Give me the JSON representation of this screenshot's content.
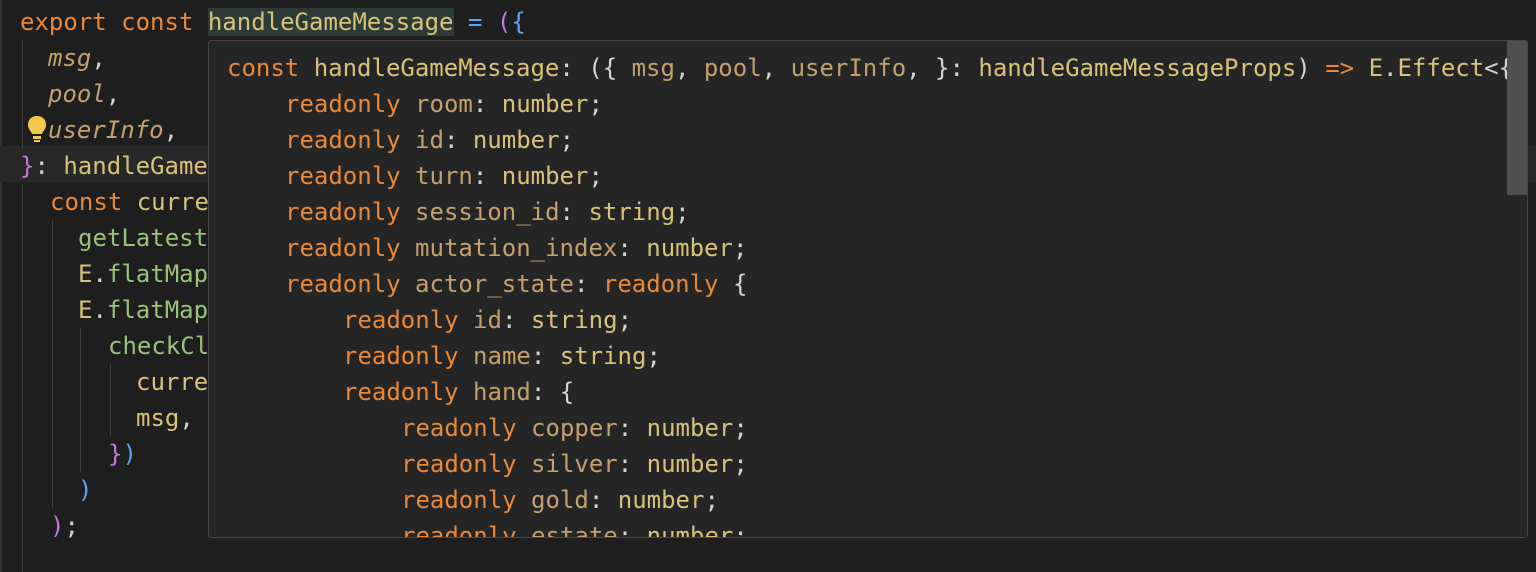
{
  "editor": {
    "lines": [
      {
        "parts": [
          [
            "kw",
            "export"
          ],
          [
            "punc",
            " "
          ],
          [
            "kw",
            "const"
          ],
          [
            "punc",
            " "
          ],
          [
            "fn hl",
            "handleGameMessage"
          ],
          [
            "punc",
            " "
          ],
          [
            "blue",
            "="
          ],
          [
            "punc",
            " "
          ],
          [
            "pink",
            "("
          ],
          [
            "blue",
            "{"
          ]
        ]
      },
      {
        "parts": [
          [
            "param",
            "msg"
          ],
          [
            "punc",
            ","
          ]
        ]
      },
      {
        "parts": [
          [
            "param",
            "pool"
          ],
          [
            "punc",
            ","
          ]
        ]
      },
      {
        "parts": [
          [
            "param",
            "userInfo"
          ],
          [
            "punc",
            ","
          ]
        ]
      },
      {
        "parts": [
          [
            "pink",
            "}"
          ],
          [
            "punc",
            ": "
          ],
          [
            "fn",
            "handleGame"
          ]
        ]
      },
      {
        "parts": [
          [
            "kw",
            "const"
          ],
          [
            "punc",
            " "
          ],
          [
            "fn",
            "curre"
          ]
        ]
      },
      {
        "parts": [
          [
            "green",
            "getLatest"
          ]
        ]
      },
      {
        "parts": [
          [
            "fn",
            "E"
          ],
          [
            "punc",
            "."
          ],
          [
            "green",
            "flatMap"
          ]
        ]
      },
      {
        "parts": [
          [
            "fn",
            "E"
          ],
          [
            "punc",
            "."
          ],
          [
            "green",
            "flatMap"
          ]
        ]
      },
      {
        "parts": [
          [
            "green",
            "checkCl"
          ]
        ]
      },
      {
        "parts": [
          [
            "fn",
            "curre"
          ]
        ]
      },
      {
        "parts": [
          [
            "fn",
            "msg"
          ],
          [
            "punc",
            ","
          ]
        ]
      },
      {
        "parts": [
          [
            "pink",
            "}"
          ],
          [
            "blue",
            ")"
          ]
        ]
      },
      {
        "parts": [
          [
            "blue",
            ")"
          ]
        ]
      },
      {
        "parts": [
          [
            "pink",
            ")"
          ],
          [
            "punc",
            ";"
          ]
        ]
      }
    ]
  },
  "hover": {
    "lines": [
      {
        "parts": [
          [
            "kw",
            "const"
          ],
          [
            "punc",
            " "
          ],
          [
            "fn",
            "handleGameMessage"
          ],
          [
            "punc",
            ": ({ "
          ],
          [
            "hprop",
            "msg"
          ],
          [
            "punc",
            ", "
          ],
          [
            "hprop",
            "pool"
          ],
          [
            "punc",
            ", "
          ],
          [
            "hprop",
            "userInfo"
          ],
          [
            "punc",
            ", }: "
          ],
          [
            "fn",
            "handleGameMessageProps"
          ],
          [
            "punc",
            ") "
          ],
          [
            "kw",
            "=>"
          ],
          [
            "punc",
            " "
          ],
          [
            "fn",
            "E"
          ],
          [
            "punc",
            "."
          ],
          [
            "fn",
            "Effect"
          ],
          [
            "punc",
            "<{"
          ]
        ]
      },
      {
        "parts": [
          [
            "kw",
            "readonly"
          ],
          [
            "punc",
            " "
          ],
          [
            "hprop",
            "room"
          ],
          [
            "punc",
            ": "
          ],
          [
            "htype",
            "number"
          ],
          [
            "punc",
            ";"
          ]
        ]
      },
      {
        "parts": [
          [
            "kw",
            "readonly"
          ],
          [
            "punc",
            " "
          ],
          [
            "hprop",
            "id"
          ],
          [
            "punc",
            ": "
          ],
          [
            "htype",
            "number"
          ],
          [
            "punc",
            ";"
          ]
        ]
      },
      {
        "parts": [
          [
            "kw",
            "readonly"
          ],
          [
            "punc",
            " "
          ],
          [
            "hprop",
            "turn"
          ],
          [
            "punc",
            ": "
          ],
          [
            "htype",
            "number"
          ],
          [
            "punc",
            ";"
          ]
        ]
      },
      {
        "parts": [
          [
            "kw",
            "readonly"
          ],
          [
            "punc",
            " "
          ],
          [
            "hprop",
            "session_id"
          ],
          [
            "punc",
            ": "
          ],
          [
            "htype",
            "string"
          ],
          [
            "punc",
            ";"
          ]
        ]
      },
      {
        "parts": [
          [
            "kw",
            "readonly"
          ],
          [
            "punc",
            " "
          ],
          [
            "hprop",
            "mutation_index"
          ],
          [
            "punc",
            ": "
          ],
          [
            "htype",
            "number"
          ],
          [
            "punc",
            ";"
          ]
        ]
      },
      {
        "parts": [
          [
            "kw",
            "readonly"
          ],
          [
            "punc",
            " "
          ],
          [
            "hprop",
            "actor_state"
          ],
          [
            "punc",
            ": "
          ],
          [
            "kw",
            "readonly"
          ],
          [
            "punc",
            " {"
          ]
        ]
      },
      {
        "parts": [
          [
            "kw",
            "readonly"
          ],
          [
            "punc",
            " "
          ],
          [
            "hprop",
            "id"
          ],
          [
            "punc",
            ": "
          ],
          [
            "htype",
            "string"
          ],
          [
            "punc",
            ";"
          ]
        ]
      },
      {
        "parts": [
          [
            "kw",
            "readonly"
          ],
          [
            "punc",
            " "
          ],
          [
            "hprop",
            "name"
          ],
          [
            "punc",
            ": "
          ],
          [
            "htype",
            "string"
          ],
          [
            "punc",
            ";"
          ]
        ]
      },
      {
        "parts": [
          [
            "kw",
            "readonly"
          ],
          [
            "punc",
            " "
          ],
          [
            "hprop",
            "hand"
          ],
          [
            "punc",
            ": {"
          ]
        ]
      },
      {
        "parts": [
          [
            "kw",
            "readonly"
          ],
          [
            "punc",
            " "
          ],
          [
            "hprop",
            "copper"
          ],
          [
            "punc",
            ": "
          ],
          [
            "htype",
            "number"
          ],
          [
            "punc",
            ";"
          ]
        ]
      },
      {
        "parts": [
          [
            "kw",
            "readonly"
          ],
          [
            "punc",
            " "
          ],
          [
            "hprop",
            "silver"
          ],
          [
            "punc",
            ": "
          ],
          [
            "htype",
            "number"
          ],
          [
            "punc",
            ";"
          ]
        ]
      },
      {
        "parts": [
          [
            "kw",
            "readonly"
          ],
          [
            "punc",
            " "
          ],
          [
            "hprop",
            "gold"
          ],
          [
            "punc",
            ": "
          ],
          [
            "htype",
            "number"
          ],
          [
            "punc",
            ";"
          ]
        ]
      },
      {
        "parts": [
          [
            "kw",
            "readonly"
          ],
          [
            "punc",
            " "
          ],
          [
            "hprop",
            "estate"
          ],
          [
            "punc",
            ": "
          ],
          [
            "htype",
            "number"
          ],
          [
            "punc",
            ";"
          ]
        ]
      }
    ]
  },
  "icons": {
    "lightbulb": "lightbulb-icon"
  }
}
